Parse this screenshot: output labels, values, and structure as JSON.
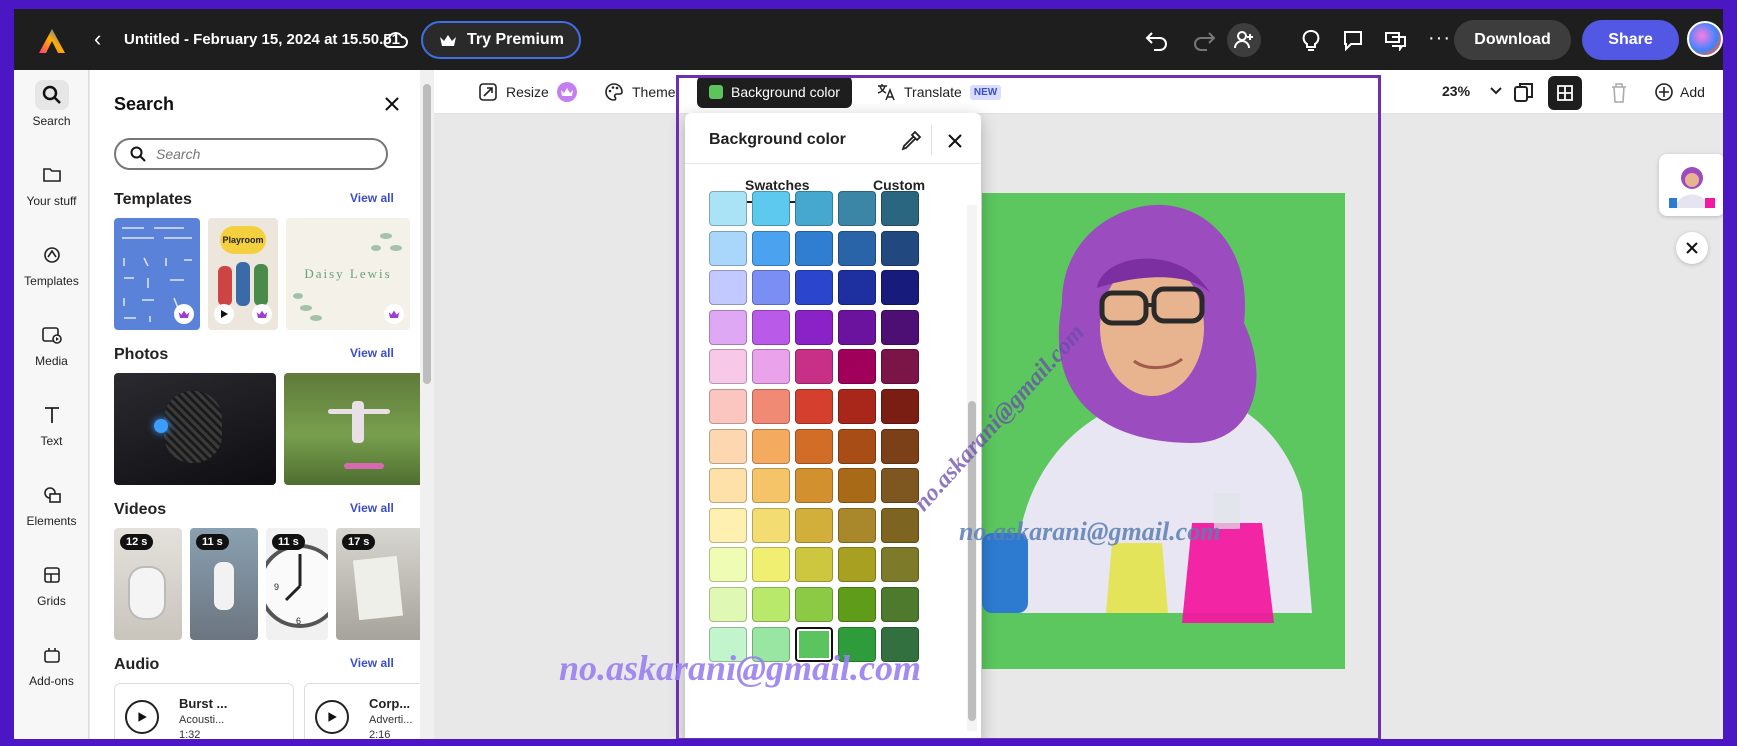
{
  "topbar": {
    "doc_title": "Untitled - February 15, 2024 at 15.50.51",
    "premium_label": "Try Premium",
    "download_label": "Download",
    "share_label": "Share"
  },
  "rail": {
    "items": [
      {
        "label": "Search",
        "icon": "search-icon"
      },
      {
        "label": "Your stuff",
        "icon": "folder-icon"
      },
      {
        "label": "Templates",
        "icon": "templates-icon"
      },
      {
        "label": "Media",
        "icon": "media-icon"
      },
      {
        "label": "Text",
        "icon": "text-icon"
      },
      {
        "label": "Elements",
        "icon": "elements-icon"
      },
      {
        "label": "Grids",
        "icon": "grids-icon"
      },
      {
        "label": "Add-ons",
        "icon": "addons-icon"
      }
    ]
  },
  "panel": {
    "title": "Search",
    "search_placeholder": "Search",
    "templates": {
      "title": "Templates",
      "view_all": "View all",
      "item3_text": "Daisy Lewis",
      "item2_text": "Playroom"
    },
    "photos": {
      "title": "Photos",
      "view_all": "View all"
    },
    "videos": {
      "title": "Videos",
      "view_all": "View all",
      "durations": [
        "12 s",
        "11 s",
        "11 s",
        "17 s"
      ]
    },
    "audio": {
      "title": "Audio",
      "view_all": "View all",
      "items": [
        {
          "title": "Burst ...",
          "genre": "Acousti...",
          "duration": "1:32"
        },
        {
          "title": "Corp...",
          "genre": "Adverti...",
          "duration": "2:16"
        }
      ]
    }
  },
  "toolbar": {
    "resize_label": "Resize",
    "theme_label": "Theme",
    "bg_color_label": "Background color",
    "translate_label": "Translate",
    "new_badge": "NEW",
    "zoom_label": "23%",
    "add_label": "Add"
  },
  "popover": {
    "title": "Background color",
    "tab_swatches": "Swatches",
    "tab_custom": "Custom",
    "selected_color": "#5cc45e",
    "swatches": [
      [
        "#a9e3f5",
        "#5dc9ee",
        "#47a8cf",
        "#3b86a6",
        "#2a6680"
      ],
      [
        "#a9d6fb",
        "#4ba3f0",
        "#2f7ed1",
        "#2a64a8",
        "#22497f"
      ],
      [
        "#c2c9ff",
        "#7b8ef4",
        "#2b46cc",
        "#1e2fa0",
        "#161b7c"
      ],
      [
        "#dea8f5",
        "#b95ae9",
        "#8a22c8",
        "#6b139e",
        "#4e0f74"
      ],
      [
        "#f8c8e8",
        "#eaa2ea",
        "#c82f86",
        "#a0005a",
        "#7b1548"
      ],
      [
        "#fcc6c0",
        "#f08a74",
        "#d43f2e",
        "#a8261a",
        "#7a1e14"
      ],
      [
        "#fdd7b0",
        "#f4ab60",
        "#d26d28",
        "#a84d16",
        "#7b4018"
      ],
      [
        "#fde1a8",
        "#f5c468",
        "#d3902e",
        "#a86a16",
        "#7d5620"
      ],
      [
        "#fdf0b0",
        "#f3dc72",
        "#d2ae3a",
        "#a8882a",
        "#7d6420"
      ],
      [
        "#eefcb4",
        "#f1ef72",
        "#cdc63f",
        "#a7a021",
        "#7d7a2a"
      ],
      [
        "#dff8b4",
        "#b9e96a",
        "#8cc944",
        "#5f9c1a",
        "#4e7a2e"
      ],
      [
        "#c2f5cc",
        "#99e6a2",
        "#5cc45e",
        "#2f9c3c",
        "#327040"
      ]
    ]
  },
  "watermarks": {
    "text": "no.askarani@gmail.com"
  },
  "colors": {
    "accent": "#5258e4",
    "border_frame": "#4b17c4",
    "canvas_green": "#5bc75e",
    "selection": "#6b2fb3"
  }
}
